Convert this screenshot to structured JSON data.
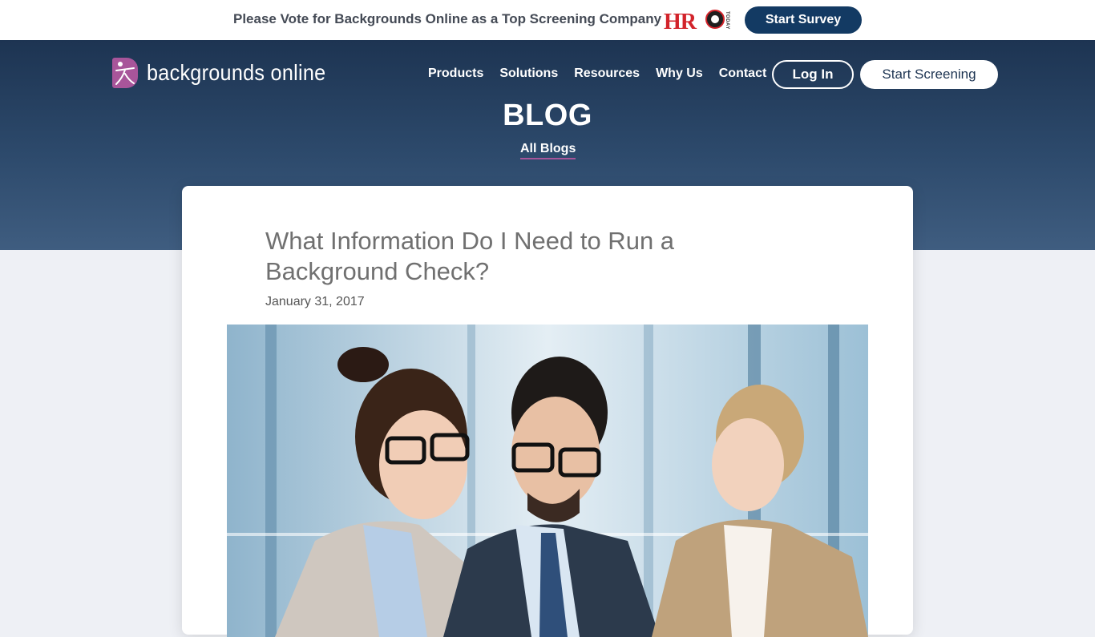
{
  "announcement": {
    "text": "Please Vote for Backgrounds Online as a Top Screening Company",
    "partner_logo": "HR",
    "partner_logo_sub": "TODAY",
    "survey_button": "Start Survey"
  },
  "header": {
    "logo_text": "backgrounds online",
    "nav": [
      "Products",
      "Solutions",
      "Resources",
      "Why Us",
      "Contact"
    ],
    "login_button": "Log In",
    "start_screening_button": "Start Screening"
  },
  "hero": {
    "title": "BLOG",
    "all_blogs_link": "All Blogs"
  },
  "article": {
    "title": "What Information Do I Need to Run a Background Check?",
    "date": "January 31, 2017",
    "image_icon": "office-team-photo"
  },
  "colors": {
    "brand_navy": "#133a63",
    "hero_top": "#1d3452",
    "hero_bottom": "#3f5d80",
    "accent_purple": "#a8559a",
    "hr_red": "#d2232a"
  }
}
